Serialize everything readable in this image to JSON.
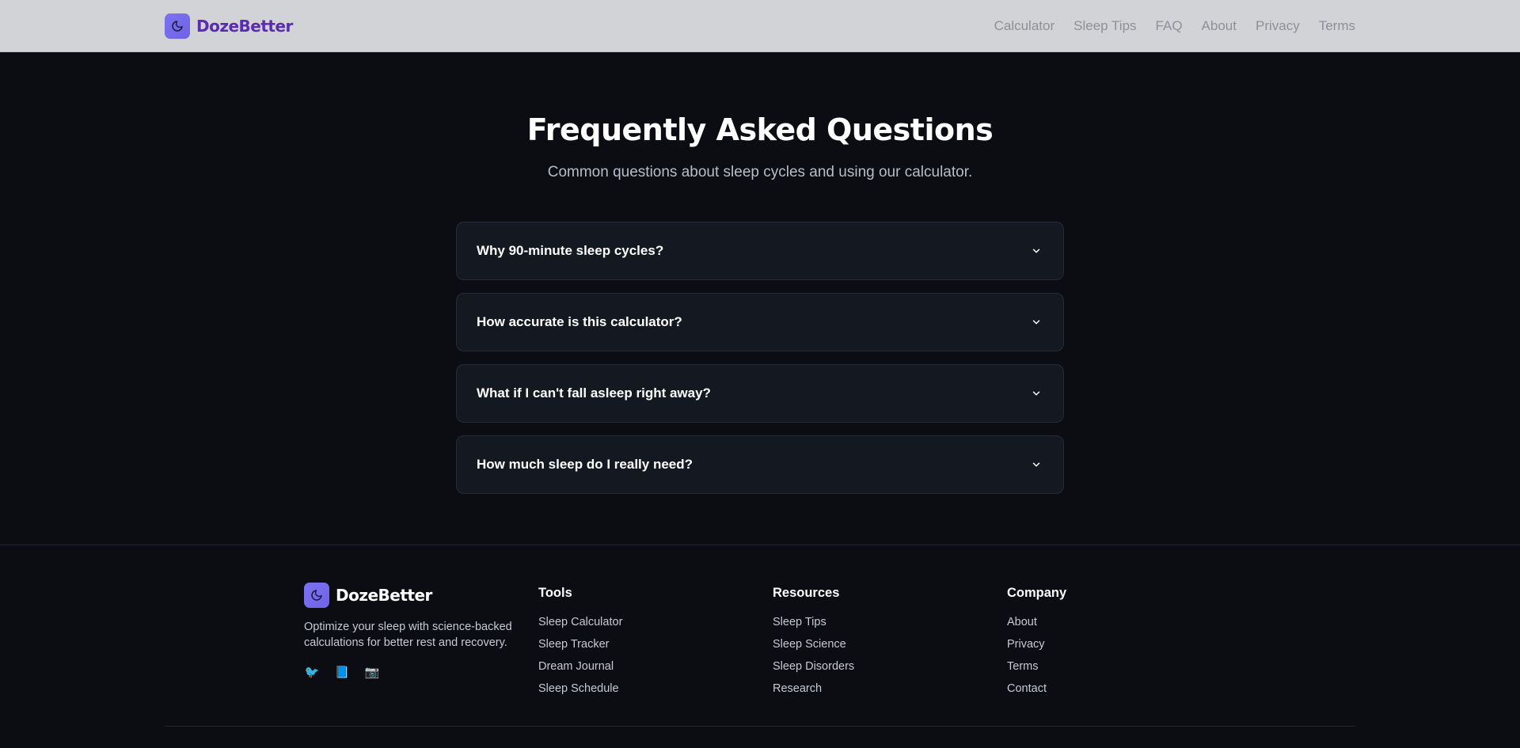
{
  "header": {
    "brand": "DozeBetter",
    "nav": [
      "Calculator",
      "Sleep Tips",
      "FAQ",
      "About",
      "Privacy",
      "Terms"
    ]
  },
  "faq": {
    "title": "Frequently Asked Questions",
    "subtitle": "Common questions about sleep cycles and using our calculator.",
    "items": [
      "Why 90-minute sleep cycles?",
      "How accurate is this calculator?",
      "What if I can't fall asleep right away?",
      "How much sleep do I really need?"
    ]
  },
  "footer": {
    "brand": "DozeBetter",
    "description": "Optimize your sleep with science-backed calculations for better rest and recovery.",
    "socials": [
      "🐦",
      "📘",
      "📷"
    ],
    "columns": [
      {
        "heading": "Tools",
        "links": [
          "Sleep Calculator",
          "Sleep Tracker",
          "Dream Journal",
          "Sleep Schedule"
        ]
      },
      {
        "heading": "Resources",
        "links": [
          "Sleep Tips",
          "Sleep Science",
          "Sleep Disorders",
          "Research"
        ]
      },
      {
        "heading": "Company",
        "links": [
          "About",
          "Privacy",
          "Terms",
          "Contact"
        ]
      }
    ]
  },
  "colors": {
    "accent": "#7b73f0",
    "brand_text": "#5b2bb3",
    "background": "#0b0d13",
    "card": "#141821"
  }
}
